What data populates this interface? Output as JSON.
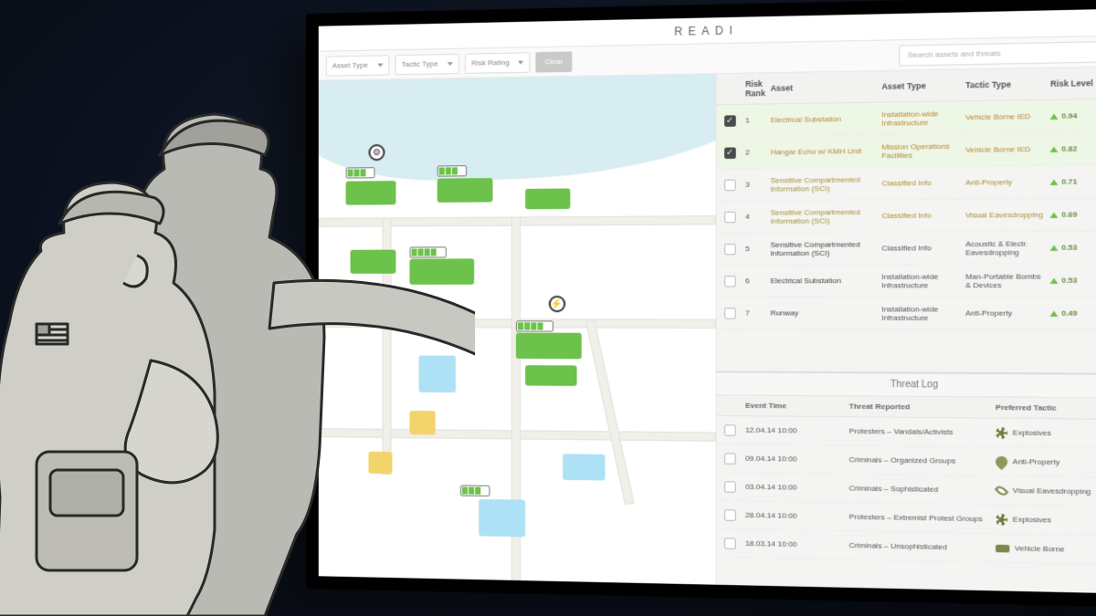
{
  "app": {
    "title": "READI"
  },
  "toolbar": {
    "filter1": "Asset Type",
    "filter2": "Tactic Type",
    "filter3": "Risk Rating",
    "clear": "Clear",
    "search_placeholder": "Search assets and threats"
  },
  "risk": {
    "headers": {
      "rank": "Risk Rank",
      "asset": "Asset",
      "atype": "Asset Type",
      "ttype": "Tactic Type",
      "level": "Risk Level"
    },
    "rows": [
      {
        "checked": true,
        "rank": "1",
        "asset": "Electrical Substation",
        "atype": "Installation-wide Infrastructure",
        "ttype": "Vehicle Borne IED",
        "level": "0.94",
        "tier": "hi"
      },
      {
        "checked": true,
        "rank": "2",
        "asset": "Hangar Echo w/ KMH Unit",
        "atype": "Mission Operations Facilities",
        "ttype": "Vehicle Borne IED",
        "level": "0.82",
        "tier": "hi"
      },
      {
        "checked": false,
        "rank": "3",
        "asset": "Sensitive Compartmented Information (SCI)",
        "atype": "Classified Info",
        "ttype": "Anti-Property",
        "level": "0.71",
        "tier": "med"
      },
      {
        "checked": false,
        "rank": "4",
        "asset": "Sensitive Compartmented Information (SCI)",
        "atype": "Classified Info",
        "ttype": "Visual Eavesdropping",
        "level": "0.69",
        "tier": "med"
      },
      {
        "checked": false,
        "rank": "5",
        "asset": "Sensitive Compartmented Information (SCI)",
        "atype": "Classified Info",
        "ttype": "Acoustic & Electr. Eavesdropping",
        "level": "0.53",
        "tier": ""
      },
      {
        "checked": false,
        "rank": "6",
        "asset": "Electrical Substation",
        "atype": "Installation-wide Infrastructure",
        "ttype": "Man-Portable Bombs & Devices",
        "level": "0.53",
        "tier": ""
      },
      {
        "checked": false,
        "rank": "7",
        "asset": "Runway",
        "atype": "Installation-wide Infrastructure",
        "ttype": "Anti-Property",
        "level": "0.49",
        "tier": ""
      }
    ]
  },
  "threatlog": {
    "title": "Threat Log",
    "headers": {
      "time": "Event Time",
      "reported": "Threat Reported",
      "tactic": "Preferred Tactic"
    },
    "rows": [
      {
        "time": "12.04.14 10:00",
        "reported": "Protesters – Vandals/Activists",
        "tactic": "Explosives",
        "icon": "expl"
      },
      {
        "time": "09.04.14 10:00",
        "reported": "Criminals – Organized Groups",
        "tactic": "Anti-Property",
        "icon": "prop"
      },
      {
        "time": "03.04.14 10:00",
        "reported": "Criminals – Sophisticated",
        "tactic": "Visual Eavesdropping",
        "icon": "eye"
      },
      {
        "time": "28.04.14 10:00",
        "reported": "Protesters – Extremist Protest Groups",
        "tactic": "Explosives",
        "icon": "expl"
      },
      {
        "time": "18.03.14 10:00",
        "reported": "Criminals – Unsophisticated",
        "tactic": "Vehicle Borne",
        "icon": "car"
      }
    ]
  }
}
